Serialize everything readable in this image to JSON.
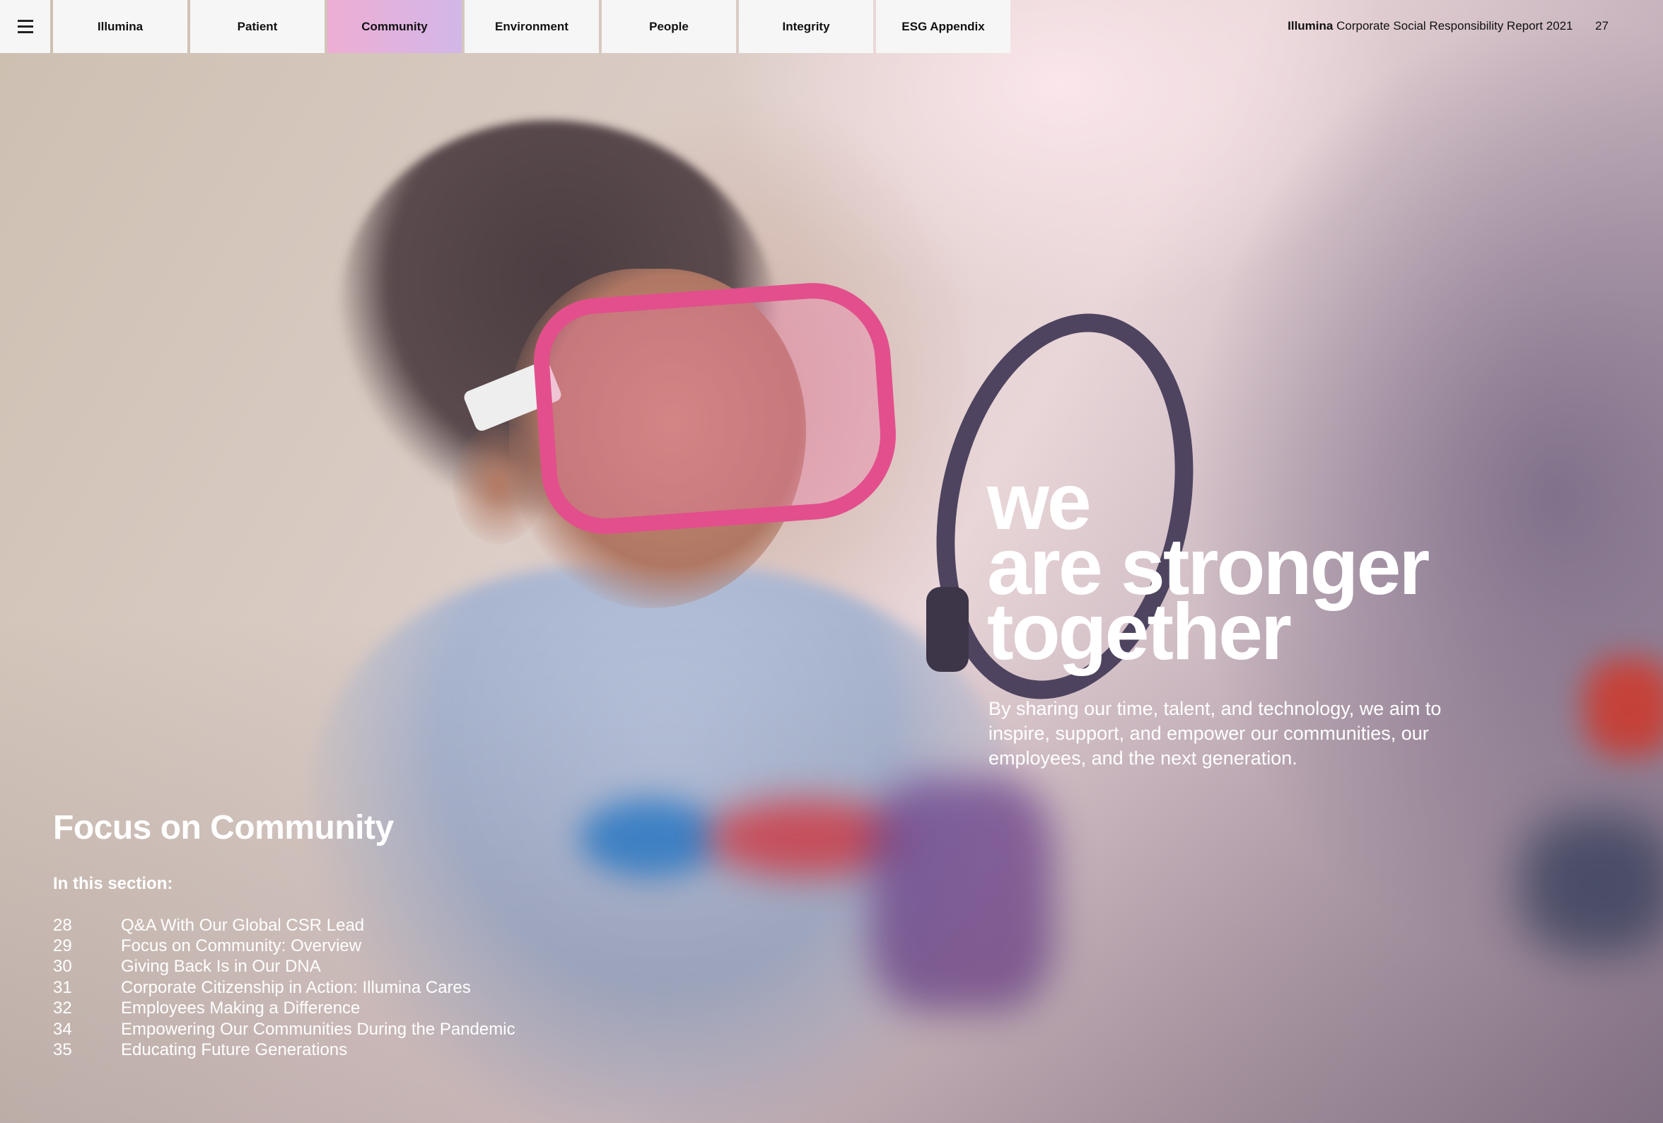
{
  "nav": {
    "menu_label": "Menu",
    "tabs": [
      {
        "label": "Illumina",
        "active": false
      },
      {
        "label": "Patient",
        "active": false
      },
      {
        "label": "Community",
        "active": true
      },
      {
        "label": "Environment",
        "active": false
      },
      {
        "label": "People",
        "active": false
      },
      {
        "label": "Integrity",
        "active": false
      },
      {
        "label": "ESG Appendix",
        "active": false
      }
    ]
  },
  "header": {
    "brand": "Illumina",
    "report_title": "Corporate Social Responsibility Report 2021",
    "page_number": "27"
  },
  "hero": {
    "headline_lines": [
      "we",
      "are stronger",
      "together"
    ],
    "lede": "By sharing our time, talent, and technology, we aim to inspire, support, and empower our communities, our employees, and the next generation."
  },
  "section": {
    "title": "Focus on Community",
    "subtitle": "In this section:",
    "items": [
      {
        "page": "28",
        "label": "Q&A With Our Global CSR Lead"
      },
      {
        "page": "29",
        "label": "Focus on Community: Overview"
      },
      {
        "page": "30",
        "label": "Giving Back Is in Our DNA"
      },
      {
        "page": "31",
        "label": "Corporate Citizenship in Action: Illumina Cares"
      },
      {
        "page": "32",
        "label": "Employees Making a Difference"
      },
      {
        "page": "34",
        "label": "Empowering Our Communities During the Pandemic"
      },
      {
        "page": "35",
        "label": "Educating Future Generations"
      }
    ]
  },
  "colors": {
    "active_tab_start": "#eeaed4",
    "active_tab_end": "#d2b7e8",
    "text_on_photo": "#ffffff"
  }
}
